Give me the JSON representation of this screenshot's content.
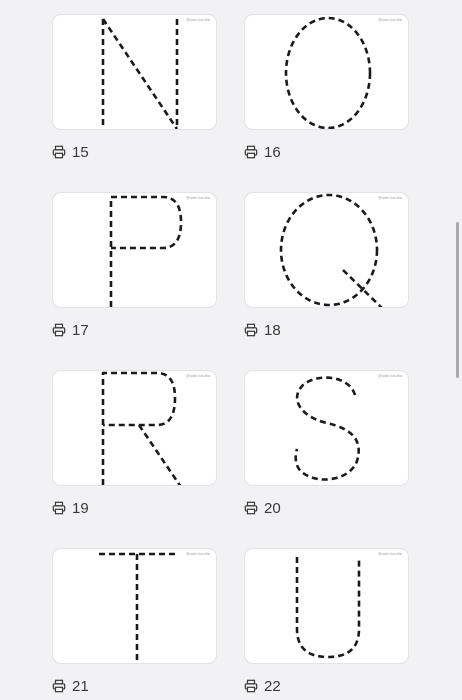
{
  "watermark": "@prof.claudia",
  "cards": [
    {
      "letter": "N",
      "number": "15"
    },
    {
      "letter": "O",
      "number": "16"
    },
    {
      "letter": "P",
      "number": "17"
    },
    {
      "letter": "Q",
      "number": "18"
    },
    {
      "letter": "R",
      "number": "19"
    },
    {
      "letter": "S",
      "number": "20"
    },
    {
      "letter": "T",
      "number": "21"
    },
    {
      "letter": "U",
      "number": "22"
    }
  ],
  "icons": {
    "print": "printer-icon"
  }
}
